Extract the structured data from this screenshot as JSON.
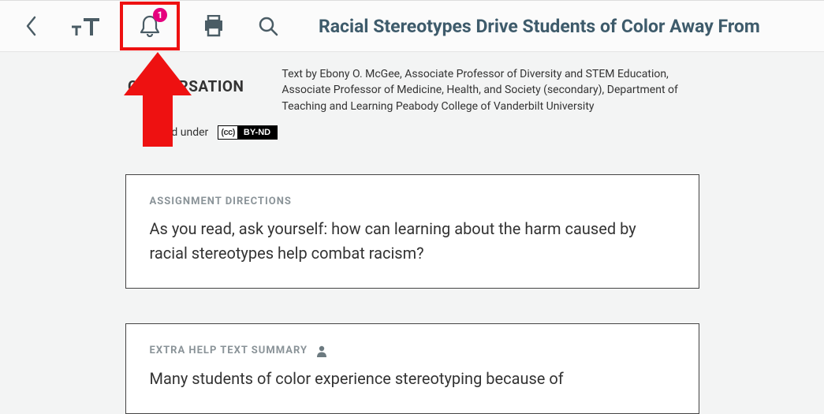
{
  "toolbar": {
    "notification_count": "1"
  },
  "title": "Racial Stereotypes Drive Students of Color Away From",
  "source": {
    "logo_prefix": "C",
    "logo_accent": "O",
    "logo_suffix": "NVERSATION",
    "byline": "Text by Ebony O. McGee, Associate Professor of Diversity and STEM Education, Associate Professor of Medicine, Health, and Society (secondary), Department of Teaching and Learning Peabody College of Vanderbilt University",
    "license_prefix": "ed under",
    "license_cc": "(cc)",
    "license_by": "BY-ND"
  },
  "cards": {
    "directions": {
      "label": "ASSIGNMENT DIRECTIONS",
      "body": "As you read, ask yourself: how can learning about the harm caused by racial stereotypes help combat racism?"
    },
    "extra_help": {
      "label": "EXTRA HELP TEXT SUMMARY",
      "body": "Many students of color experience stereotyping because of"
    }
  }
}
